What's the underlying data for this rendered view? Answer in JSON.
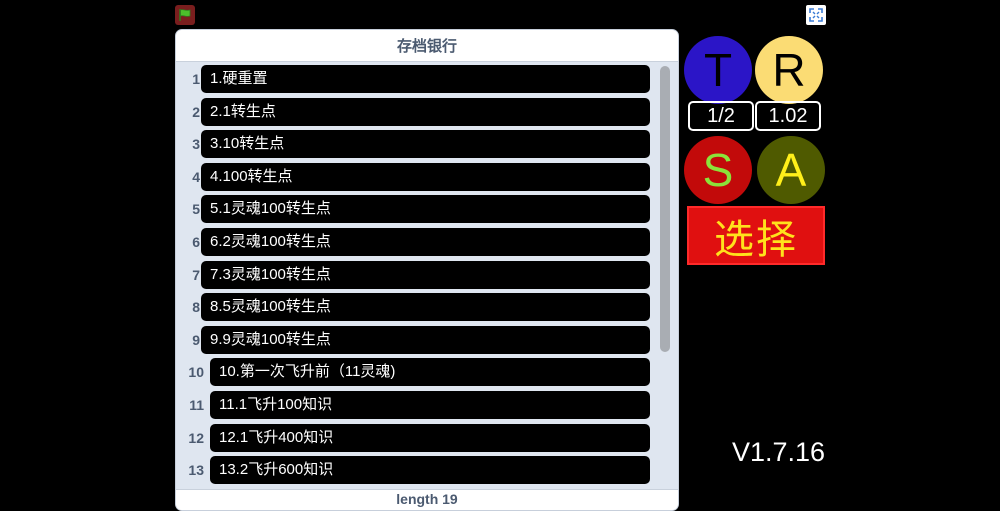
{
  "panel": {
    "title": "存档银行",
    "footer": "length 19",
    "items": [
      {
        "num": "1",
        "label": "1.硬重置"
      },
      {
        "num": "2",
        "label": "2.1转生点"
      },
      {
        "num": "3",
        "label": "3.10转生点"
      },
      {
        "num": "4",
        "label": "4.100转生点"
      },
      {
        "num": "5",
        "label": "5.1灵魂100转生点"
      },
      {
        "num": "6",
        "label": "6.2灵魂100转生点"
      },
      {
        "num": "7",
        "label": "7.3灵魂100转生点"
      },
      {
        "num": "8",
        "label": "8.5灵魂100转生点"
      },
      {
        "num": "9",
        "label": "9.9灵魂100转生点"
      },
      {
        "num": "10",
        "label": "10.第一次飞升前（11灵魂)"
      },
      {
        "num": "11",
        "label": "11.1飞升100知识"
      },
      {
        "num": "12",
        "label": "12.1飞升400知识"
      },
      {
        "num": "13",
        "label": "13.2飞升600知识"
      }
    ]
  },
  "buttons": {
    "t": {
      "label": "T",
      "bg": "#2b15c7",
      "fg": "#000000"
    },
    "r": {
      "label": "R",
      "bg": "#fbdc74",
      "fg": "#000000"
    },
    "s": {
      "label": "S",
      "bg": "#c20a0a",
      "fg": "#8be33a"
    },
    "a": {
      "label": "A",
      "bg": "#4f5a00",
      "fg": "#ffef1a"
    },
    "select": "选择"
  },
  "values": {
    "page": "1/2",
    "speed": "1.02"
  },
  "version": "V1.7.16"
}
